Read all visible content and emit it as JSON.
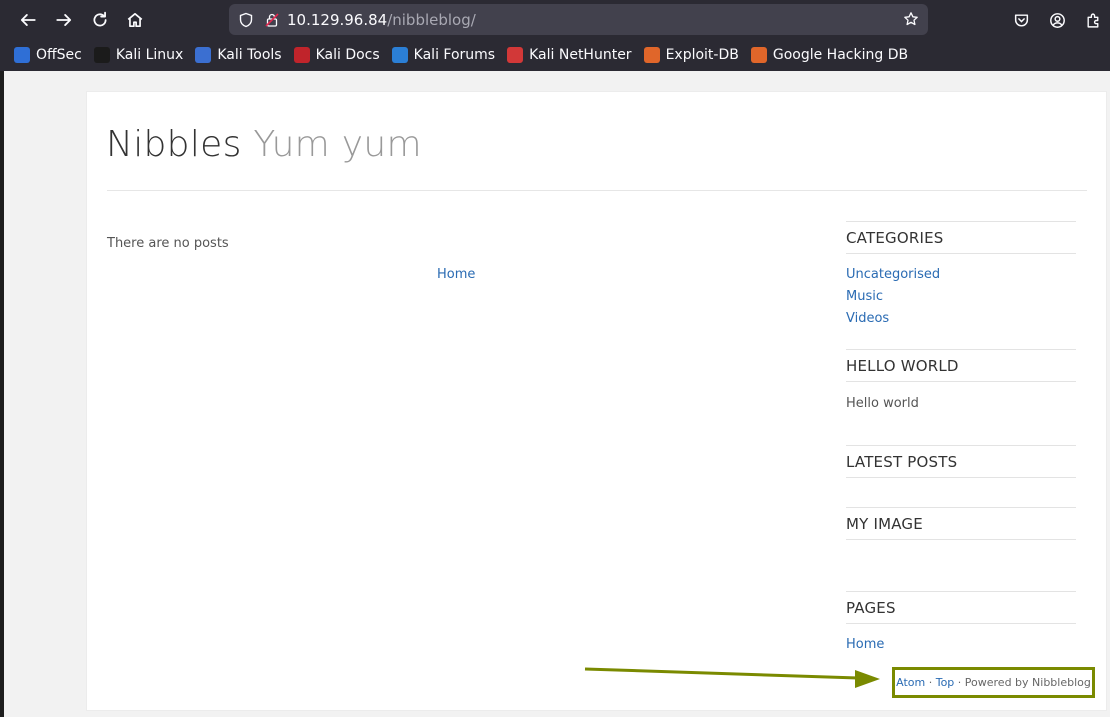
{
  "browser": {
    "url_host": "10.129.96.84",
    "url_path": "/nibbleblog/",
    "bookmarks": [
      {
        "label": "OffSec",
        "color": "#2f6fd6"
      },
      {
        "label": "Kali Linux",
        "color": "#1b1b1b"
      },
      {
        "label": "Kali Tools",
        "color": "#3b6fd1"
      },
      {
        "label": "Kali Docs",
        "color": "#c0242b"
      },
      {
        "label": "Kali Forums",
        "color": "#2b7fd6"
      },
      {
        "label": "Kali NetHunter",
        "color": "#d23838"
      },
      {
        "label": "Exploit-DB",
        "color": "#e0662a"
      },
      {
        "label": "Google Hacking DB",
        "color": "#e0662a"
      }
    ]
  },
  "blog": {
    "title": "Nibbles",
    "slogan": "Yum yum",
    "no_posts": "There are no posts",
    "home_link": "Home"
  },
  "sidebar": {
    "categories_heading": "CATEGORIES",
    "categories": [
      "Uncategorised",
      "Music",
      "Videos"
    ],
    "hello_heading": "HELLO WORLD",
    "hello_text": "Hello world",
    "latest_heading": "LATEST POSTS",
    "image_heading": "MY IMAGE",
    "pages_heading": "PAGES",
    "pages": [
      "Home"
    ]
  },
  "footer": {
    "atom": "Atom",
    "sep1": " · ",
    "top": "Top",
    "sep2": " · ",
    "powered": "Powered by Nibbleblog"
  },
  "annotation": {
    "highlight_color": "#7a8a00"
  }
}
